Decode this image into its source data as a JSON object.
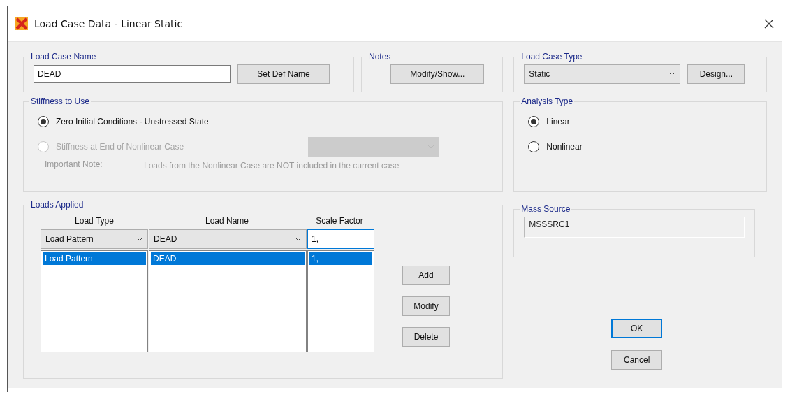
{
  "window": {
    "title": "Load Case Data - Linear Static"
  },
  "load_case_name": {
    "label": "Load Case Name",
    "value": "DEAD",
    "button": "Set Def Name"
  },
  "notes": {
    "label": "Notes",
    "button": "Modify/Show..."
  },
  "load_case_type": {
    "label": "Load Case Type",
    "value": "Static",
    "button": "Design..."
  },
  "stiffness": {
    "label": "Stiffness to Use",
    "options": [
      {
        "label": "Zero Initial Conditions - Unstressed State",
        "selected": true,
        "disabled": false
      },
      {
        "label": "Stiffness at End of Nonlinear Case",
        "selected": false,
        "disabled": true
      }
    ],
    "case_dropdown": {
      "disabled": true
    },
    "note_label": "Important Note:",
    "note_text": "Loads from the Nonlinear Case are NOT included in the current case"
  },
  "analysis_type": {
    "label": "Analysis Type",
    "options": [
      {
        "label": "Linear",
        "selected": true
      },
      {
        "label": "Nonlinear",
        "selected": false
      }
    ]
  },
  "loads_applied": {
    "label": "Loads Applied",
    "columns": [
      "Load Type",
      "Load Name",
      "Scale Factor"
    ],
    "editor": {
      "load_type": "Load Pattern",
      "load_name": "DEAD",
      "scale_factor": "1,"
    },
    "rows": [
      {
        "load_type": "Load Pattern",
        "load_name": "DEAD",
        "scale_factor": "1,",
        "selected": true
      }
    ],
    "buttons": [
      "Add",
      "Modify",
      "Delete"
    ]
  },
  "mass_source": {
    "label": "Mass Source",
    "value": "MSSSRC1"
  },
  "buttons": [
    {
      "label": "OK",
      "default": true
    },
    {
      "label": "Cancel",
      "default": false
    }
  ]
}
